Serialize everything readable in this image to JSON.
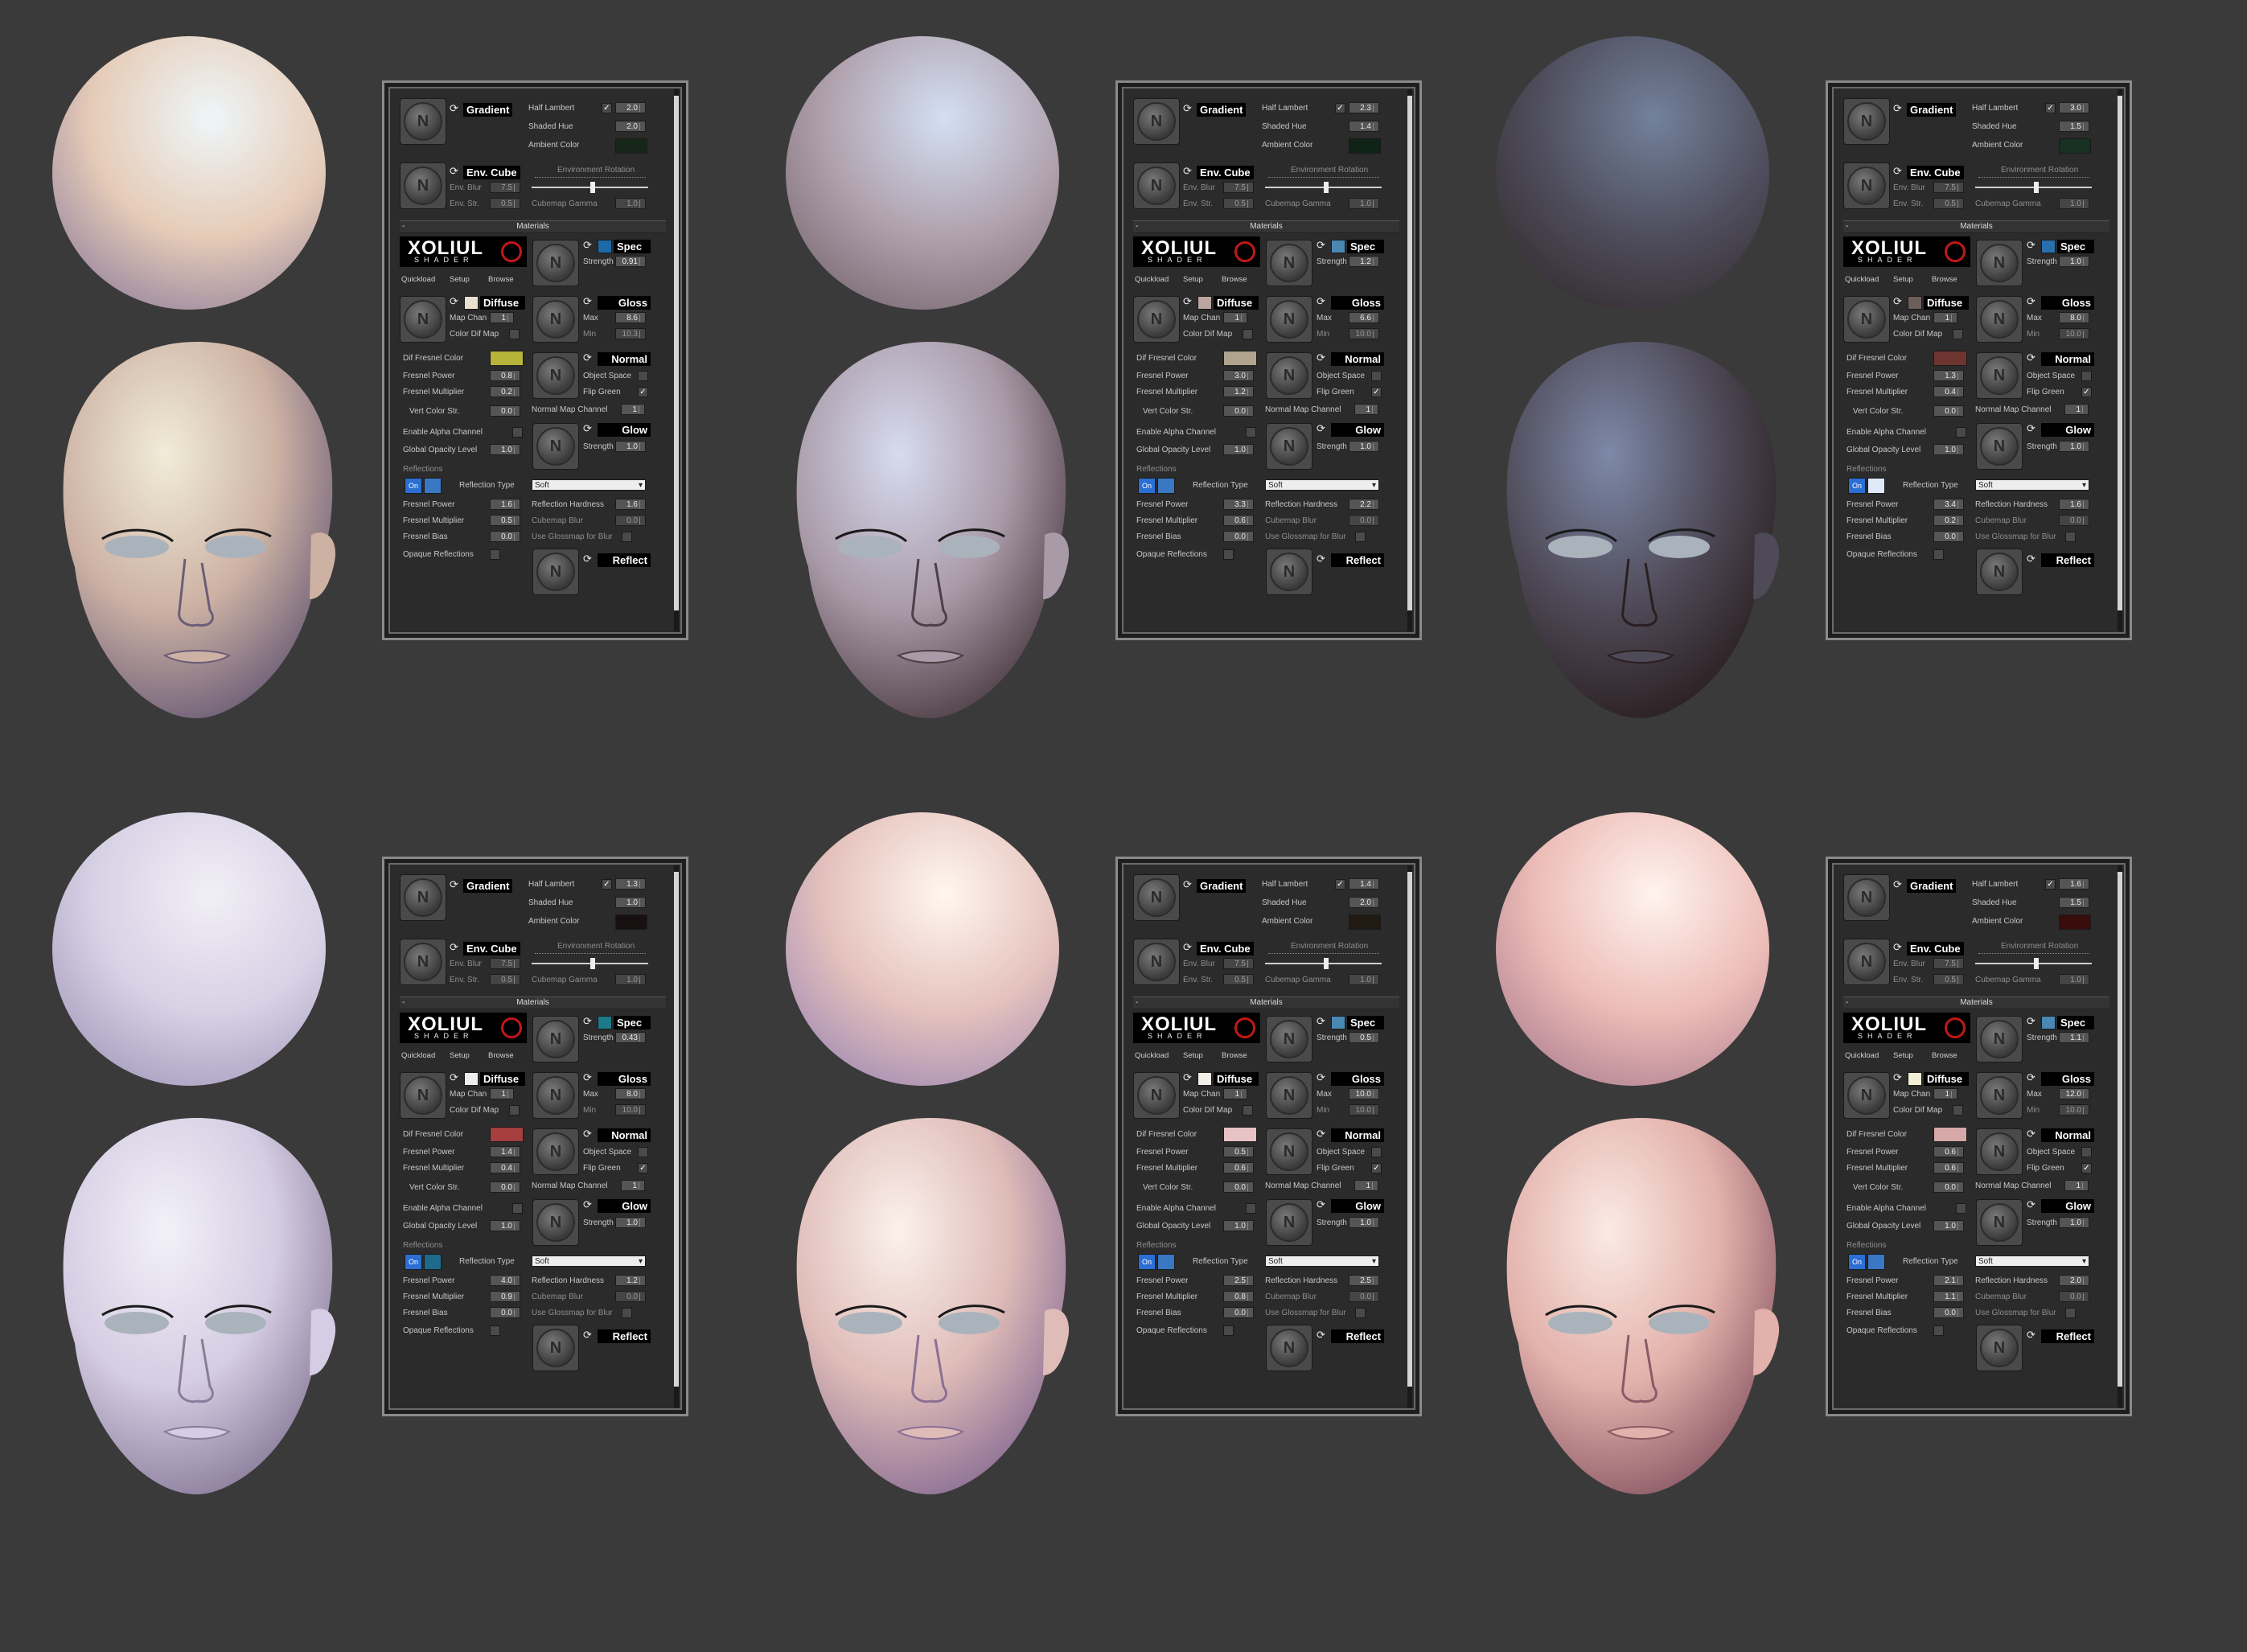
{
  "labels": {
    "gradient": "Gradient",
    "half_lambert": "Half Lambert",
    "shaded_hue": "Shaded Hue",
    "ambient_color": "Ambient Color",
    "env_cube": "Env. Cube",
    "env_blur": "Env. Blur",
    "env_str": "Env. Str.",
    "environment_rotation": "Environment Rotation",
    "cubemap_gamma": "Cubemap Gamma",
    "materials": "Materials",
    "xoliul": "XOLIUL",
    "shader": "SHADER",
    "quickload": "Quickload",
    "setup": "Setup",
    "browse": "Browse",
    "spec": "Spec",
    "strength": "Strength",
    "diffuse": "Diffuse",
    "map_chan": "Map Chan",
    "color_dif_map": "Color Dif Map",
    "gloss": "Gloss",
    "max": "Max",
    "min": "Min",
    "dif_fresnel_color": "Dif Fresnel Color",
    "fresnel_power": "Fresnel Power",
    "fresnel_multiplier": "Fresnel Multiplier",
    "normal": "Normal",
    "object_space": "Object Space",
    "flip_green": "Flip Green",
    "vert_color_str": "Vert Color Str.",
    "normal_map_channel": "Normal Map Channel",
    "enable_alpha_channel": "Enable Alpha Channel",
    "global_opacity_level": "Global Opacity Level",
    "glow": "Glow",
    "reflections": "Reflections",
    "on": "On",
    "reflection_type": "Reflection Type",
    "fresnel_bias": "Fresnel Bias",
    "reflection_hardness": "Reflection Hardness",
    "cubemap_blur": "Cubemap Blur",
    "use_glossmap_for_blur": "Use Glossmap for Blur",
    "opaque_reflections": "Opaque Reflections",
    "reflect": "Reflect",
    "minus": "-",
    "check": "✓",
    "logo_letter": "N"
  },
  "variants": [
    {
      "half_lambert": "2.0",
      "shaded_hue": "2.0",
      "ambient_color": "#16271a",
      "env_blur": "7.5",
      "env_str": "0.5",
      "cubemap_gamma": "1.0",
      "env_rotation": 0.5,
      "spec_color": "#1e6aa8",
      "spec_strength": "0.91",
      "diffuse_color": "#e9e0cf",
      "map_chan": "1",
      "gloss_max": "8.6",
      "gloss_min": "10.3",
      "dif_fresnel_color": "#b8b33a",
      "fresnel_power": "0.8",
      "fresnel_multiplier": "0.2",
      "vert_color_str": "0.0",
      "normal_map_channel": "1",
      "global_opacity_level": "1.0",
      "glow_strength": "1.0",
      "refl_color": "#3a78c4",
      "reflection_type": "Soft",
      "refl_fresnel_power": "1.6",
      "refl_fresnel_multiplier": "0.5",
      "refl_fresnel_bias": "0.0",
      "reflection_hardness": "1.6",
      "cubemap_blur": "0.0",
      "sphere_light": "#eef6f9",
      "sphere_mid": "#e6ccb8",
      "sphere_dark": "#7d6d95",
      "skin_light": "#f1ecd9",
      "skin_mid": "#cdb2a4",
      "skin_dark": "#6c5d77"
    },
    {
      "half_lambert": "2.3",
      "shaded_hue": "1.4",
      "ambient_color": "#0f2416",
      "env_blur": "7.5",
      "env_str": "0.5",
      "cubemap_gamma": "1.0",
      "env_rotation": 0.5,
      "spec_color": "#4a88b4",
      "spec_strength": "1.2",
      "diffuse_color": "#bca59e",
      "map_chan": "1",
      "gloss_max": "6.6",
      "gloss_min": "10.0",
      "dif_fresnel_color": "#b0a48e",
      "fresnel_power": "3.0",
      "fresnel_multiplier": "1.2",
      "vert_color_str": "0.0",
      "normal_map_channel": "1",
      "global_opacity_level": "1.0",
      "glow_strength": "1.0",
      "refl_color": "#3a78c4",
      "reflection_type": "Soft",
      "refl_fresnel_power": "3.3",
      "refl_fresnel_multiplier": "0.6",
      "refl_fresnel_bias": "0.0",
      "reflection_hardness": "2.2",
      "cubemap_blur": "0.0",
      "sphere_light": "#d3dff3",
      "sphere_mid": "#b0a1ad",
      "sphere_dark": "#6a5a62",
      "skin_light": "#d7dbef",
      "skin_mid": "#a99aa8",
      "skin_dark": "#4e3f46"
    },
    {
      "half_lambert": "3.0",
      "shaded_hue": "1.5",
      "ambient_color": "#173022",
      "env_blur": "7.5",
      "env_str": "0.5",
      "cubemap_gamma": "1.0",
      "env_rotation": 0.5,
      "spec_color": "#2a6eae",
      "spec_strength": "1.0",
      "diffuse_color": "#6e5e5a",
      "map_chan": "1",
      "gloss_max": "8.0",
      "gloss_min": "10.0",
      "dif_fresnel_color": "#6e3430",
      "fresnel_power": "1.3",
      "fresnel_multiplier": "0.4",
      "vert_color_str": "0.0",
      "normal_map_channel": "1",
      "global_opacity_level": "1.0",
      "glow_strength": "1.0",
      "refl_color": "#dfe9f7",
      "reflection_type": "Soft",
      "refl_fresnel_power": "3.4",
      "refl_fresnel_multiplier": "0.2",
      "refl_fresnel_bias": "0.0",
      "reflection_hardness": "1.6",
      "cubemap_blur": "0.0",
      "sphere_light": "#72819b",
      "sphere_mid": "#4f4d5c",
      "sphere_dark": "#2c2323",
      "skin_light": "#7d89a8",
      "skin_mid": "#4f4a58",
      "skin_dark": "#2a1f20"
    },
    {
      "half_lambert": "1.3",
      "shaded_hue": "1.0",
      "ambient_color": "#170f10",
      "env_blur": "7.5",
      "env_str": "0.5",
      "cubemap_gamma": "1.0",
      "env_rotation": 0.5,
      "spec_color": "#1d7a8a",
      "spec_strength": "0.43",
      "diffuse_color": "#eeeeee",
      "map_chan": "1",
      "gloss_max": "8.0",
      "gloss_min": "10.0",
      "dif_fresnel_color": "#a53e3e",
      "fresnel_power": "1.4",
      "fresnel_multiplier": "0.4",
      "vert_color_str": "0.0",
      "normal_map_channel": "1",
      "global_opacity_level": "1.0",
      "glow_strength": "1.0",
      "refl_color": "#1f6a8c",
      "reflection_type": "Soft",
      "refl_fresnel_power": "4.0",
      "refl_fresnel_multiplier": "0.9",
      "refl_fresnel_bias": "0.0",
      "reflection_hardness": "1.2",
      "cubemap_blur": "0.0",
      "sphere_light": "#f1eff6",
      "sphere_mid": "#d7d1e5",
      "sphere_dark": "#958aaf",
      "skin_light": "#f2f1f8",
      "skin_mid": "#d5cde3",
      "skin_dark": "#8a7c9a"
    },
    {
      "half_lambert": "1.4",
      "shaded_hue": "2.0",
      "ambient_color": "#211a12",
      "env_blur": "7.5",
      "env_str": "0.5",
      "cubemap_gamma": "1.0",
      "env_rotation": 0.5,
      "spec_color": "#4a88b4",
      "spec_strength": "0.5",
      "diffuse_color": "#f2efe8",
      "map_chan": "1",
      "gloss_max": "10.0",
      "gloss_min": "10.0",
      "dif_fresnel_color": "#e8c3c5",
      "fresnel_power": "0.5",
      "fresnel_multiplier": "0.6",
      "vert_color_str": "0.0",
      "normal_map_channel": "1",
      "global_opacity_level": "1.0",
      "glow_strength": "1.0",
      "refl_color": "#3a78c4",
      "reflection_type": "Soft",
      "refl_fresnel_power": "2.5",
      "refl_fresnel_multiplier": "0.8",
      "refl_fresnel_bias": "0.0",
      "reflection_hardness": "2.5",
      "cubemap_blur": "0.0",
      "sphere_light": "#fff7ee",
      "sphere_mid": "#e5c2bd",
      "sphere_dark": "#8e7ab0",
      "skin_light": "#fbf1ec",
      "skin_mid": "#dfbcb8",
      "skin_dark": "#8c6f95"
    },
    {
      "half_lambert": "1.6",
      "shaded_hue": "1.5",
      "ambient_color": "#3a0d0d",
      "env_blur": "7.5",
      "env_str": "0.5",
      "cubemap_gamma": "1.0",
      "env_rotation": 0.5,
      "spec_color": "#4a88b4",
      "spec_strength": "1.1",
      "diffuse_color": "#f3efd6",
      "map_chan": "1",
      "gloss_max": "12.0",
      "gloss_min": "10.0",
      "dif_fresnel_color": "#d7a8a8",
      "fresnel_power": "0.6",
      "fresnel_multiplier": "0.6",
      "vert_color_str": "0.0",
      "normal_map_channel": "1",
      "global_opacity_level": "1.0",
      "glow_strength": "1.0",
      "refl_color": "#3a78c4",
      "reflection_type": "Soft",
      "refl_fresnel_power": "2.1",
      "refl_fresnel_multiplier": "1.1",
      "refl_fresnel_bias": "0.0",
      "reflection_hardness": "2.0",
      "cubemap_blur": "0.0",
      "sphere_light": "#fff3ee",
      "sphere_mid": "#edbdb8",
      "sphere_dark": "#9e6f86",
      "skin_light": "#fbeae4",
      "skin_mid": "#e3b1ab",
      "skin_dark": "#8c5a66"
    }
  ]
}
